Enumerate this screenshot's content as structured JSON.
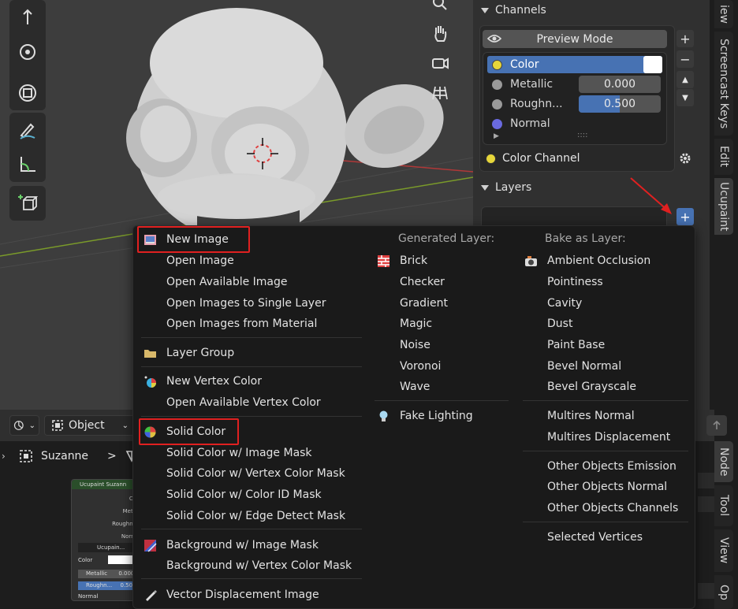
{
  "viewport": {
    "tools": [
      "select-tool",
      "transform-tool",
      "scale-tool",
      "transform-all-tool",
      "annotate-tool",
      "measure-tool",
      "add-cube-tool"
    ],
    "nav": [
      "zoom-icon",
      "hand-icon",
      "camera-icon",
      "grid-icon"
    ]
  },
  "channels": {
    "header": "Channels",
    "preview_mode": "Preview Mode",
    "items": [
      {
        "label": "Color",
        "value": "",
        "dot": "#e6d63a"
      },
      {
        "label": "Metallic",
        "value": "0.000",
        "dot": "#9a9a9a"
      },
      {
        "label": "Roughn...",
        "value": "0.500",
        "dot": "#9a9a9a"
      },
      {
        "label": "Normal",
        "value": "",
        "dot": "#6a6ae0"
      }
    ],
    "resize_dots": "::::",
    "color_channel": "Color Channel"
  },
  "layers": {
    "header": "Layers",
    "add_label": "+"
  },
  "tabs": {
    "top": [
      "iew",
      "Screencast Keys",
      "Edit",
      "Ucupaint"
    ],
    "bottom": [
      "Node",
      "Tool",
      "View",
      "Op"
    ]
  },
  "nodebar": {
    "mode": "Object",
    "breadcrumb": [
      "Suzanne",
      ">"
    ]
  },
  "node": {
    "title": "Ucupaint Suzann",
    "rows": [
      "Co",
      "Meta",
      "Roughne",
      "Norm"
    ],
    "group": "Ucupain...",
    "inputs": [
      {
        "label": "Color",
        "value": ""
      },
      {
        "label": "Metallic",
        "value": "0.000"
      },
      {
        "label": "Roughn...",
        "value": "0.500"
      }
    ],
    "normal": "Normal"
  },
  "menu": {
    "col1": [
      {
        "label": "New Image",
        "icon": "image-icon",
        "highlight": true
      },
      {
        "label": "Open Image"
      },
      {
        "label": "Open Available Image"
      },
      {
        "label": "Open Images to Single Layer"
      },
      {
        "label": "Open Images from Material"
      },
      {
        "label": "Layer Group",
        "icon": "folder-icon"
      },
      {
        "label": "New Vertex Color",
        "icon": "vertex-color-icon"
      },
      {
        "label": "Open Available Vertex Color"
      },
      {
        "label": "Solid Color",
        "icon": "color-wheel-icon",
        "highlight": true
      },
      {
        "label": "Solid Color w/ Image Mask"
      },
      {
        "label": "Solid Color w/ Vertex Color Mask"
      },
      {
        "label": "Solid Color w/ Color ID Mask"
      },
      {
        "label": "Solid Color w/ Edge Detect Mask"
      },
      {
        "label": "Background w/ Image Mask",
        "icon": "background-icon"
      },
      {
        "label": "Background w/ Vertex Color Mask"
      },
      {
        "label": "Vector Displacement Image",
        "icon": "brush-icon"
      }
    ],
    "col2_head": "Generated Layer:",
    "col2": [
      {
        "label": "Brick",
        "icon": "brick-icon"
      },
      {
        "label": "Checker"
      },
      {
        "label": "Gradient"
      },
      {
        "label": "Magic"
      },
      {
        "label": "Noise"
      },
      {
        "label": "Voronoi"
      },
      {
        "label": "Wave"
      },
      {
        "label": "Fake Lighting",
        "icon": "light-bulb-icon"
      }
    ],
    "col3_head": "Bake as Layer:",
    "col3": [
      {
        "label": "Ambient Occlusion",
        "icon": "camera-bake-icon"
      },
      {
        "label": "Pointiness"
      },
      {
        "label": "Cavity"
      },
      {
        "label": "Dust"
      },
      {
        "label": "Paint Base"
      },
      {
        "label": "Bevel Normal"
      },
      {
        "label": "Bevel Grayscale"
      },
      {
        "label": "Multires Normal"
      },
      {
        "label": "Multires Displacement"
      },
      {
        "label": "Other Objects Emission"
      },
      {
        "label": "Other Objects Normal"
      },
      {
        "label": "Other Objects Channels"
      },
      {
        "label": "Selected Vertices"
      }
    ]
  }
}
